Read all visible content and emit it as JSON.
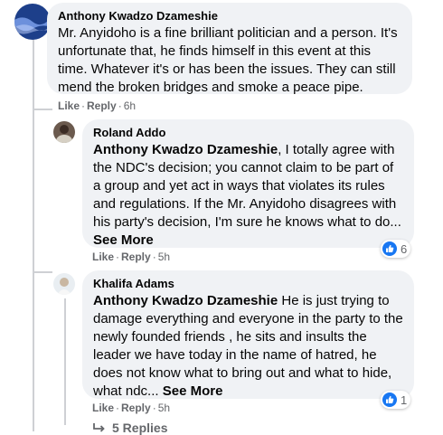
{
  "comments": [
    {
      "author": "Anthony Kwadzo Dzameshie",
      "text": "Mr. Anyidoho is a fine brilliant politician and a person. It's unfortunate that, he finds himself in this event at this time. Whatever it's or has been the issues. They can still mend the broken bridges and smoke a peace pipe.",
      "like": "Like",
      "reply": "Reply",
      "time": "6h"
    },
    {
      "author": "Roland Addo",
      "mention": "Anthony Kwadzo Dzameshie",
      "text": ", I totally agree with the NDC's decision; you cannot claim to be part of a group and yet act in ways that violates its rules and regulations. If the Mr. Anyidoho disagrees with his party's decision, I'm sure he knows what to do...",
      "see_more": "See More",
      "like": "Like",
      "reply": "Reply",
      "time": "5h",
      "reaction_count": "6"
    },
    {
      "author": "Khalifa Adams",
      "mention": "Anthony Kwadzo Dzameshie",
      "text": " He is just trying to damage everything and everyone in the party to the newly founded friends , he sits and insults the leader we have today in the name of hatred, he does not know what to bring out and what to hide, what ndc...",
      "see_more": "See More",
      "like": "Like",
      "reply": "Reply",
      "time": "5h",
      "reaction_count": "1"
    }
  ],
  "replies_link": "5 Replies",
  "colors": {
    "bubble": "#f0f2f5",
    "meta": "#65676b",
    "like_blue": "#1877f2",
    "thread_line": "#ced0d4"
  },
  "icons": {
    "like_badge": "thumbs-up-icon",
    "replies_arrow": "reply-arrow-icon"
  }
}
